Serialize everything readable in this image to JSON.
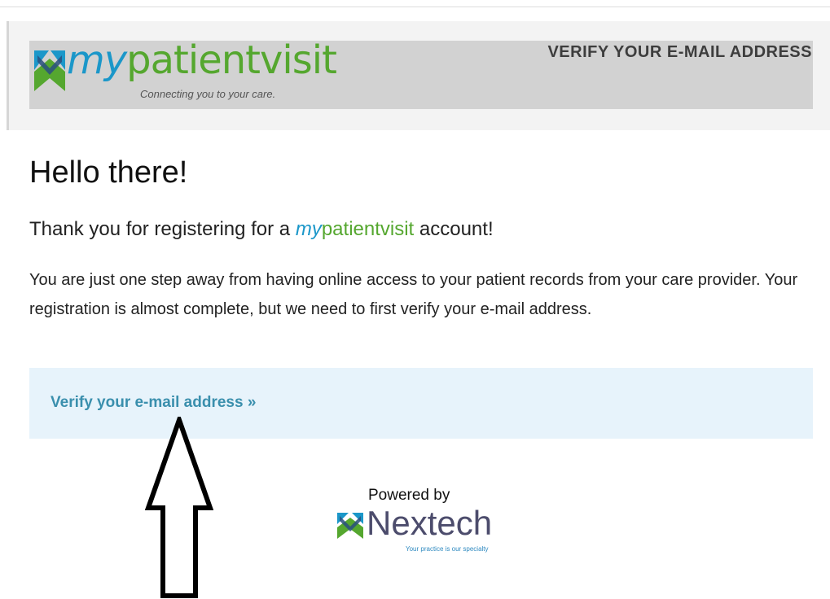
{
  "header": {
    "logo": {
      "word_italic": "my",
      "word_rest": "patientvisit",
      "tagline": "Connecting you to your care."
    },
    "title": "VERIFY YOUR E-MAIL ADDRESS"
  },
  "content": {
    "greeting": "Hello there!",
    "thanks_prefix": "Thank you for registering for a ",
    "brand_italic": "my",
    "brand_rest": "patientvisit",
    "thanks_suffix": " account!",
    "body": "You are just one step away from having online access to your patient records from your care provider. Your registration is almost complete, but we need to first verify your e-mail address."
  },
  "cta": {
    "label": "Verify your e-mail address »"
  },
  "footer": {
    "powered_by": "Powered by",
    "brand": "Nextech",
    "tagline": "Your practice is our specialty"
  },
  "annotation": {
    "icon": "up-arrow-icon"
  },
  "colors": {
    "brand_blue": "#1b97c9",
    "brand_green": "#55a72f",
    "link": "#3a8fad",
    "cta_panel": "#e7f3fb",
    "header_bar": "#d2d2d2"
  }
}
